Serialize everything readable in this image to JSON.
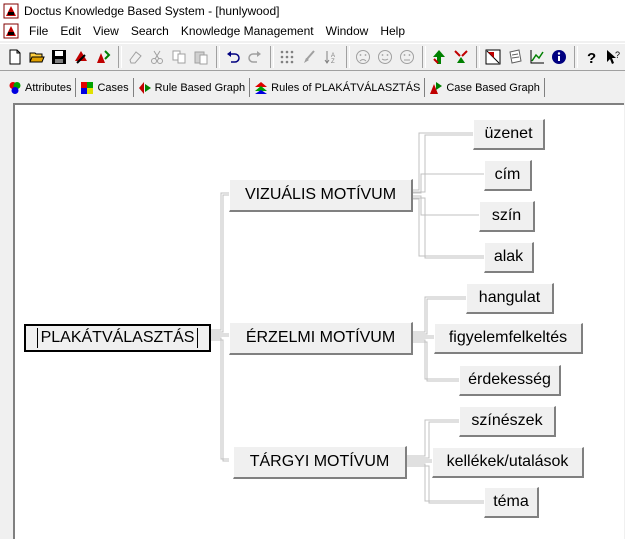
{
  "window": {
    "title": "Doctus Knowledge Based System - [hunlywood]"
  },
  "menu": [
    "File",
    "Edit",
    "View",
    "Search",
    "Knowledge Management",
    "Window",
    "Help"
  ],
  "toolbar": {
    "icons": [
      "new-file-icon",
      "open-folder-icon",
      "save-icon",
      "rule-icon",
      "case-icon",
      "eraser-icon",
      "cut-icon",
      "copy-icon",
      "paste-icon",
      "undo-icon",
      "redo-icon",
      "grid-icon",
      "brush-icon",
      "sort-icon",
      "sad-face-icon",
      "neutral-face-icon",
      "smile-face-icon",
      "tree-icon",
      "reduce-icon",
      "graph-icon",
      "notes-icon",
      "chart-icon",
      "info-icon",
      "help-icon",
      "pointer-help-icon"
    ]
  },
  "tabs": [
    {
      "label": "Attributes",
      "icon": "attributes-icon"
    },
    {
      "label": "Cases",
      "icon": "cases-icon"
    },
    {
      "label": "Rule Based Graph",
      "icon": "rule-graph-icon",
      "active": true
    },
    {
      "label": "Rules of PLAKÁTVÁLASZTÁS",
      "icon": "rules-icon"
    },
    {
      "label": "Case Based Graph",
      "icon": "case-graph-icon"
    }
  ],
  "graph": {
    "root": "PLAKÁTVÁLASZTÁS",
    "groups": [
      {
        "label": "VIZUÁLIS MOTÍVUM",
        "children": [
          "üzenet",
          "cím",
          "szín",
          "alak"
        ]
      },
      {
        "label": "ÉRZELMI MOTÍVUM",
        "children": [
          "hangulat",
          "figyelemfelkeltés",
          "érdekesség"
        ]
      },
      {
        "label": "TÁRGYI MOTÍVUM",
        "children": [
          "színészek",
          "kellékek/utalások",
          "téma"
        ]
      }
    ]
  },
  "colors": {
    "window_bg": "#f0f0f0",
    "canvas_bg": "#ffffff",
    "line": "#c0c0c0"
  }
}
